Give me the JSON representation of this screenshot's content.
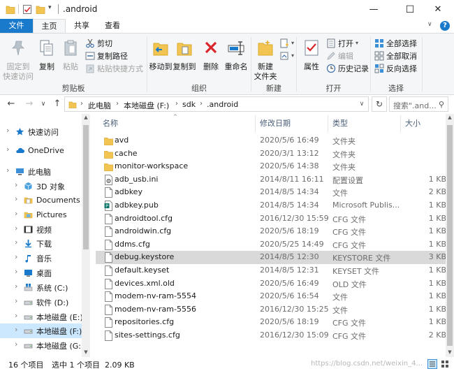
{
  "window": {
    "title": ".android",
    "minimize_glyph": "—",
    "maximize_glyph": "☐",
    "close_glyph": "✕"
  },
  "tabs": {
    "file": "文件",
    "home": "主页",
    "share": "共享",
    "view": "查看",
    "collapse_glyph": "∨",
    "help_glyph": "?"
  },
  "ribbon": {
    "clipboard": {
      "pin_label_1": "固定到",
      "pin_label_2": "快速访问",
      "copy": "复制",
      "paste": "粘贴",
      "cut": "剪切",
      "copy_path": "复制路径",
      "paste_shortcut": "粘贴快捷方式",
      "group_label": "剪贴板"
    },
    "organize": {
      "move_to": "移动到",
      "copy_to": "复制到",
      "delete": "删除",
      "rename": "重命名",
      "group_label": "组织"
    },
    "new": {
      "new_folder_1": "新建",
      "new_folder_2": "文件夹",
      "group_label": "新建"
    },
    "open": {
      "properties": "属性",
      "open": "打开",
      "edit": "编辑",
      "history": "历史记录",
      "group_label": "打开"
    },
    "select": {
      "select_all": "全部选择",
      "select_none": "全部取消",
      "invert": "反向选择",
      "group_label": "选择"
    }
  },
  "address": {
    "crumbs": [
      "此电脑",
      "本地磁盘 (F:)",
      "sdk",
      ".android"
    ],
    "search_placeholder": "搜索\".and...",
    "back_glyph": "←",
    "forward_glyph": "→",
    "recent_glyph": "∨",
    "up_glyph": "↑",
    "dropdown_glyph": "∨",
    "refresh_glyph": "↻",
    "separator_glyph": "›",
    "search_glyph": "⚲"
  },
  "nav": {
    "items": [
      {
        "label": "快速访问",
        "icon": "star-icon",
        "color": "#1979ca"
      },
      {
        "label": "OneDrive",
        "icon": "cloud-icon",
        "color": "#1979ca"
      },
      {
        "label": "此电脑",
        "icon": "computer-icon",
        "color": "#3b8fd6"
      },
      {
        "label": "3D 对象",
        "icon": "cube-icon",
        "color": "#4aa0dd"
      },
      {
        "label": "Documents",
        "icon": "document-folder-icon",
        "color": "#8a8a8a"
      },
      {
        "label": "Pictures",
        "icon": "pictures-folder-icon",
        "color": "#8a8a8a"
      },
      {
        "label": "视频",
        "icon": "video-icon",
        "color": "#333333"
      },
      {
        "label": "下载",
        "icon": "download-icon",
        "color": "#1979ca"
      },
      {
        "label": "音乐",
        "icon": "music-icon",
        "color": "#1979ca"
      },
      {
        "label": "桌面",
        "icon": "desktop-icon",
        "color": "#1979ca"
      },
      {
        "label": "系统 (C:)",
        "icon": "windows-drive-icon",
        "color": "#1979ca"
      },
      {
        "label": "软件 (D:)",
        "icon": "drive-icon",
        "color": "#777777"
      },
      {
        "label": "本地磁盘 (E:)",
        "icon": "drive-icon",
        "color": "#777777"
      },
      {
        "label": "本地磁盘 (F:)",
        "icon": "drive-icon",
        "color": "#777777",
        "selected": true
      },
      {
        "label": "本地磁盘 (G:)",
        "icon": "drive-icon",
        "color": "#777777"
      }
    ],
    "expand_glyph": "›"
  },
  "list": {
    "headers": {
      "name": "名称",
      "date": "修改日期",
      "type": "类型",
      "size": "大小"
    },
    "sort_glyph": "^",
    "rows": [
      {
        "name": "avd",
        "date": "2020/5/6 16:49",
        "type": "文件夹",
        "size": "",
        "icon": "folder-icon"
      },
      {
        "name": "cache",
        "date": "2020/3/1 13:12",
        "type": "文件夹",
        "size": "",
        "icon": "folder-icon"
      },
      {
        "name": "monitor-workspace",
        "date": "2020/5/6 14:38",
        "type": "文件夹",
        "size": "",
        "icon": "folder-icon"
      },
      {
        "name": "adb_usb.ini",
        "date": "2014/8/11 16:11",
        "type": "配置设置",
        "size": "1 KB",
        "icon": "settings-file-icon"
      },
      {
        "name": "adbkey",
        "date": "2014/8/5 14:34",
        "type": "文件",
        "size": "2 KB",
        "icon": "file-icon"
      },
      {
        "name": "adbkey.pub",
        "date": "2014/8/5 14:34",
        "type": "Microsoft Publis...",
        "size": "1 KB",
        "icon": "publisher-file-icon"
      },
      {
        "name": "androidtool.cfg",
        "date": "2016/12/30 15:59",
        "type": "CFG 文件",
        "size": "1 KB",
        "icon": "file-icon"
      },
      {
        "name": "androidwin.cfg",
        "date": "2020/5/6 18:19",
        "type": "CFG 文件",
        "size": "1 KB",
        "icon": "file-icon"
      },
      {
        "name": "ddms.cfg",
        "date": "2020/5/25 14:49",
        "type": "CFG 文件",
        "size": "1 KB",
        "icon": "file-icon"
      },
      {
        "name": "debug.keystore",
        "date": "2014/8/5 12:30",
        "type": "KEYSTORE 文件",
        "size": "3 KB",
        "icon": "file-icon",
        "selected": true
      },
      {
        "name": "default.keyset",
        "date": "2014/8/5 12:31",
        "type": "KEYSET 文件",
        "size": "1 KB",
        "icon": "file-icon"
      },
      {
        "name": "devices.xml.old",
        "date": "2020/5/6 16:49",
        "type": "OLD 文件",
        "size": "1 KB",
        "icon": "file-icon"
      },
      {
        "name": "modem-nv-ram-5554",
        "date": "2020/5/6 16:54",
        "type": "文件",
        "size": "1 KB",
        "icon": "file-icon"
      },
      {
        "name": "modem-nv-ram-5556",
        "date": "2016/12/30 15:25",
        "type": "文件",
        "size": "1 KB",
        "icon": "file-icon"
      },
      {
        "name": "repositories.cfg",
        "date": "2020/5/6 18:19",
        "type": "CFG 文件",
        "size": "1 KB",
        "icon": "file-icon"
      },
      {
        "name": "sites-settings.cfg",
        "date": "2016/12/30 15:09",
        "type": "CFG 文件",
        "size": "2 KB",
        "icon": "file-icon"
      }
    ]
  },
  "status": {
    "count": "16 个项目",
    "selected": "选中 1 个项目  2.09 KB",
    "watermark": "https://blog.csdn.net/weixin_4..."
  },
  "colors": {
    "accent": "#1979ca",
    "folder": "#f2c552",
    "folder_dark": "#dcaa2f",
    "selected_row": "#d9d9d9",
    "selected_nav": "#cce8ff",
    "delete_red": "#d9262b"
  }
}
